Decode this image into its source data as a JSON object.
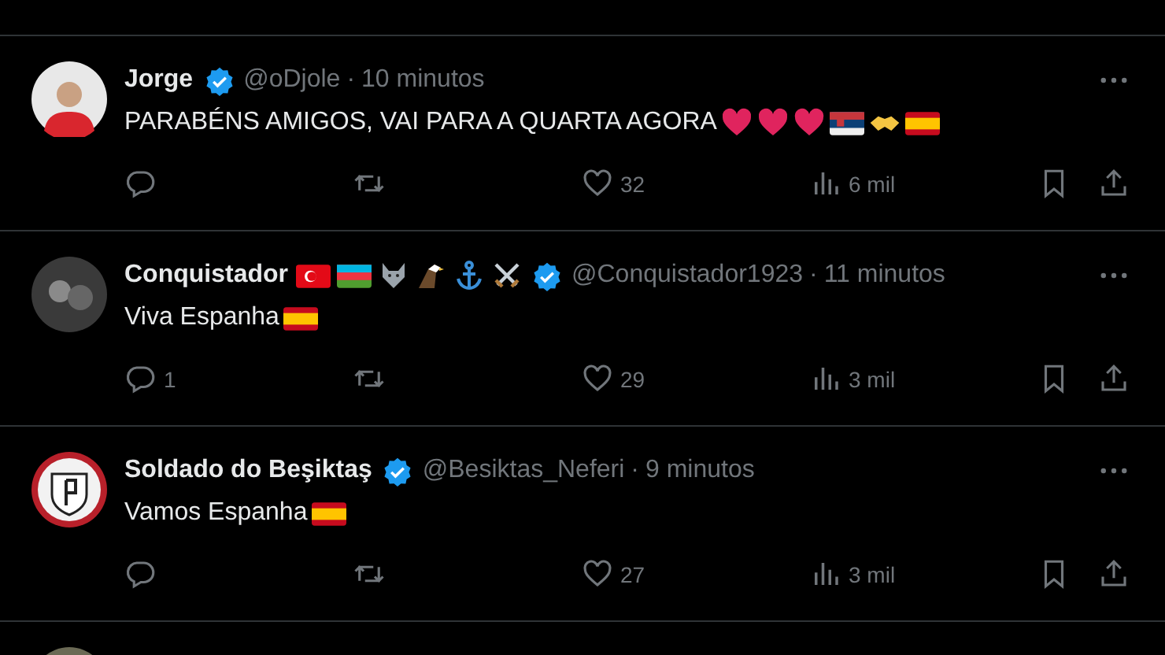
{
  "tweets": [
    {
      "avatar": {
        "kind": "portrait"
      },
      "name": "Jorge",
      "verified": true,
      "handle": "@oDjole",
      "separator": "·",
      "time": "10 minutos",
      "text": "PARABÉNS AMIGOS, VAI PARA A QUARTA AGORA",
      "text_emojis": [
        {
          "kind": "heart"
        },
        {
          "kind": "heart"
        },
        {
          "kind": "heart"
        },
        {
          "kind": "flag-serbia"
        },
        {
          "kind": "handshake"
        },
        {
          "kind": "flag-spain"
        }
      ],
      "likes": "32",
      "views": "6 mil"
    },
    {
      "avatar": {
        "kind": "photo"
      },
      "name": "Conquistador",
      "name_emojis": [
        {
          "kind": "flag-turkey"
        },
        {
          "kind": "flag-azerbaijan"
        },
        {
          "kind": "wolf"
        },
        {
          "kind": "eagle"
        },
        {
          "kind": "anchor"
        },
        {
          "kind": "swords"
        }
      ],
      "verified": true,
      "handle": "@Conquistador1923",
      "separator": "·",
      "time": "11 minutos",
      "text": "Viva Espanha",
      "text_emojis": [
        {
          "kind": "flag-spain"
        }
      ],
      "replies": "1",
      "likes": "29",
      "views": "3 mil"
    },
    {
      "avatar": {
        "kind": "crest"
      },
      "name": "Soldado do Beşiktaş",
      "verified": true,
      "handle": "@Besiktas_Neferi",
      "separator": "·",
      "time": "9 minutos",
      "text": "Vamos Espanha",
      "text_emojis": [
        {
          "kind": "flag-spain"
        }
      ],
      "likes": "27",
      "views": "3 mil"
    }
  ]
}
